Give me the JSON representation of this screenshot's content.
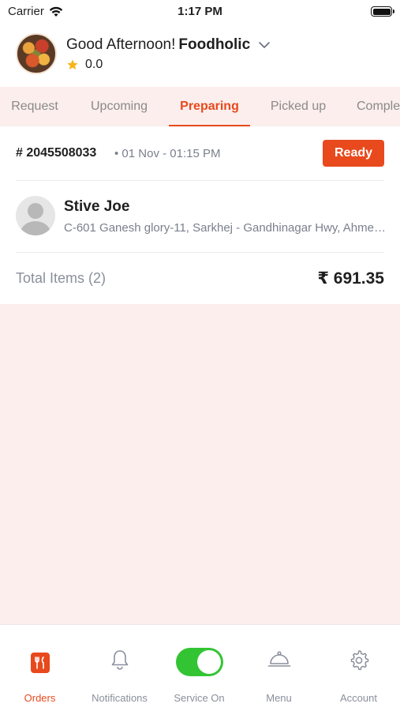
{
  "status_bar": {
    "carrier": "Carrier",
    "time": "1:17 PM"
  },
  "header": {
    "greeting": "Good Afternoon!",
    "restaurant_name": "Foodholic",
    "rating": "0.0"
  },
  "tabs": [
    {
      "label": "Request",
      "active": false
    },
    {
      "label": "Upcoming",
      "active": false
    },
    {
      "label": "Preparing",
      "active": true
    },
    {
      "label": "Picked up",
      "active": false
    },
    {
      "label": "Completed",
      "active": false
    }
  ],
  "order": {
    "id": "# 2045508033",
    "date": "• 01 Nov - 01:15 PM",
    "action_label": "Ready",
    "customer_name": "Stive Joe",
    "customer_address": "C-601 Ganesh glory-11, Sarkhej - Gandhinagar Hwy, Ahmedabad",
    "total_items_label": "Total Items (2)",
    "total_amount": "₹ 691.35"
  },
  "bottom_nav": [
    {
      "label": "Orders",
      "icon": "orders-icon",
      "active": true
    },
    {
      "label": "Notifications",
      "icon": "bell-icon",
      "active": false
    },
    {
      "label": "Service On",
      "icon": "toggle-switch",
      "active": false
    },
    {
      "label": "Menu",
      "icon": "cloche-icon",
      "active": false
    },
    {
      "label": "Account",
      "icon": "gear-icon",
      "active": false
    }
  ],
  "colors": {
    "accent": "#e8491d",
    "background": "#fbeeec",
    "toggle_on": "#33c433",
    "muted_text": "#7a7f8c"
  }
}
